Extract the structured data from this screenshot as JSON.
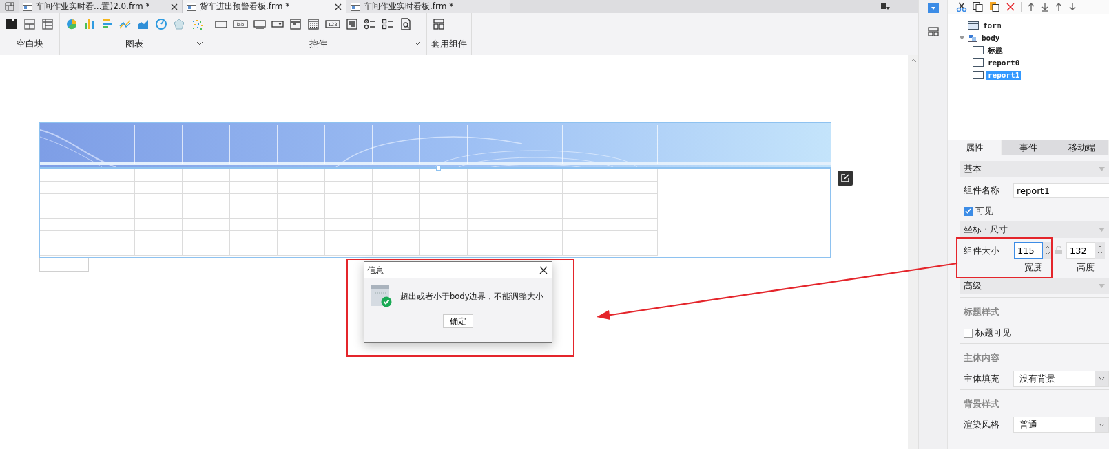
{
  "tabs": [
    {
      "label": "车间作业实时看...置)2.0.frm *",
      "selected": false,
      "closable": true
    },
    {
      "label": "货车进出预警看板.frm *",
      "selected": true,
      "closable": true
    },
    {
      "label": "车间作业实时看板.frm *",
      "selected": false,
      "closable": false
    }
  ],
  "toolbar": [
    {
      "kind": "blank",
      "label": "空白块",
      "dropdown": false,
      "icons": [
        {
          "kind": "block"
        },
        {
          "kind": "split"
        },
        {
          "kind": "table"
        }
      ]
    },
    {
      "kind": "chart",
      "label": "图表",
      "dropdown": true,
      "icons": [
        {
          "kind": "pie"
        },
        {
          "kind": "bars"
        },
        {
          "kind": "hbars"
        },
        {
          "kind": "line"
        },
        {
          "kind": "area"
        },
        {
          "kind": "gauge"
        },
        {
          "kind": "radar"
        },
        {
          "kind": "scatter"
        }
      ]
    },
    {
      "kind": "widget",
      "label": "控件",
      "dropdown": true,
      "icons": [
        {
          "kind": "rect"
        },
        {
          "kind": "text",
          "text": "lab"
        },
        {
          "kind": "input"
        },
        {
          "kind": "combo"
        },
        {
          "kind": "window"
        },
        {
          "kind": "calendar"
        },
        {
          "kind": "text",
          "text": "123"
        },
        {
          "kind": "textarea"
        },
        {
          "kind": "radio"
        },
        {
          "kind": "check"
        },
        {
          "kind": "search"
        }
      ]
    },
    {
      "kind": "template",
      "label": "套用组件",
      "dropdown": false,
      "icons": [
        {
          "kind": "layout"
        }
      ]
    }
  ],
  "dialog": {
    "title": "信息",
    "message": "超出或者小于body边界，不能调整大小",
    "button": "确定"
  },
  "tree": [
    {
      "label": "form",
      "selected": false
    },
    {
      "label": "body",
      "selected": false,
      "expanded": true,
      "children": [
        {
          "label": "标题",
          "selected": false
        },
        {
          "label": "report0",
          "selected": false
        },
        {
          "label": "report1",
          "selected": true
        }
      ]
    }
  ],
  "panel_tabs": [
    {
      "label": "属性",
      "selected": true
    },
    {
      "label": "事件",
      "selected": false
    },
    {
      "label": "移动端",
      "selected": false
    }
  ],
  "properties": [
    {
      "kind": "header",
      "label": "基本"
    },
    {
      "kind": "text",
      "label": "组件名称",
      "value": "report1"
    },
    {
      "kind": "checkbox",
      "label": "可见",
      "checked": true
    },
    {
      "kind": "header",
      "label": "坐标 · 尺寸"
    },
    {
      "kind": "size",
      "label": "组件大小",
      "locked": false,
      "fields": [
        {
          "value": "115",
          "caption": "宽度",
          "focused": true
        },
        {
          "value": "132",
          "caption": "高度",
          "focused": false
        }
      ]
    },
    {
      "kind": "header",
      "label": "高级"
    },
    {
      "kind": "subheader",
      "label": "标题样式"
    },
    {
      "kind": "checkbox",
      "label": "标题可见",
      "checked": false
    },
    {
      "kind": "subheader",
      "label": "主体内容"
    },
    {
      "kind": "select",
      "label": "主体填充",
      "value": "没有背景"
    },
    {
      "kind": "subheader",
      "label": "背景样式"
    },
    {
      "kind": "select",
      "label": "渲染风格",
      "value": "普通"
    }
  ]
}
